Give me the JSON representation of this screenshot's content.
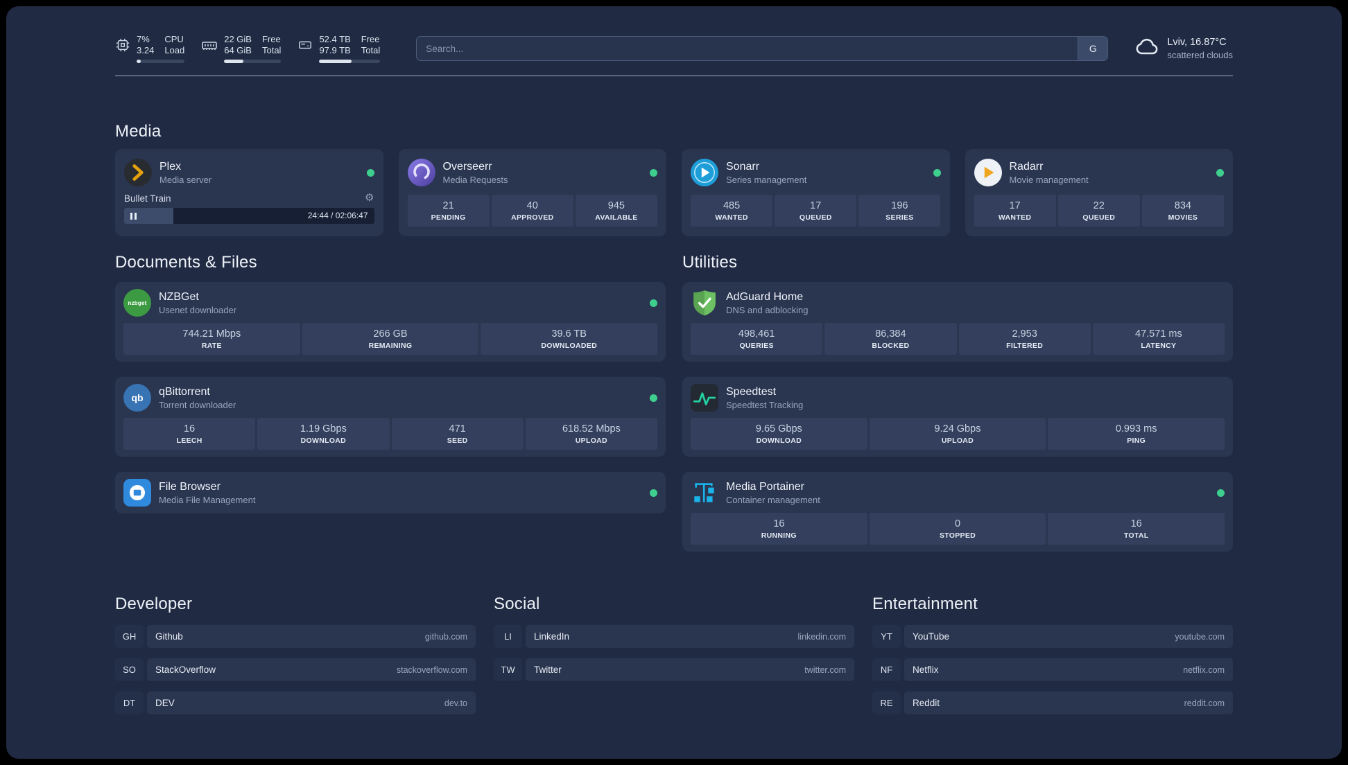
{
  "topbar": {
    "cpu": {
      "value_top": "7%",
      "value_bottom": "3.24",
      "label_top": "CPU",
      "label_bottom": "Load",
      "bar_width": "8%"
    },
    "memory": {
      "value_top": "22 GiB",
      "value_bottom": "64 GiB",
      "label_top": "Free",
      "label_bottom": "Total",
      "bar_width": "34%"
    },
    "disk": {
      "value_top": "52.4 TB",
      "value_bottom": "97.9 TB",
      "label_top": "Free",
      "label_bottom": "Total",
      "bar_width": "53%"
    },
    "search": {
      "placeholder": "Search...",
      "button_label": "G"
    },
    "weather": {
      "location": "Lviv, 16.87°C",
      "condition": "scattered clouds"
    }
  },
  "media": {
    "heading": "Media",
    "plex": {
      "name": "Plex",
      "desc": "Media server",
      "now_playing": "Bullet Train",
      "time": "24:44 / 02:06:47",
      "progress": "19.6%"
    },
    "overseerr": {
      "name": "Overseerr",
      "desc": "Media Requests",
      "stats": [
        {
          "value": "21",
          "label": "PENDING"
        },
        {
          "value": "40",
          "label": "APPROVED"
        },
        {
          "value": "945",
          "label": "AVAILABLE"
        }
      ]
    },
    "sonarr": {
      "name": "Sonarr",
      "desc": "Series management",
      "stats": [
        {
          "value": "485",
          "label": "WANTED"
        },
        {
          "value": "17",
          "label": "QUEUED"
        },
        {
          "value": "196",
          "label": "SERIES"
        }
      ]
    },
    "radarr": {
      "name": "Radarr",
      "desc": "Movie management",
      "stats": [
        {
          "value": "17",
          "label": "WANTED"
        },
        {
          "value": "22",
          "label": "QUEUED"
        },
        {
          "value": "834",
          "label": "MOVIES"
        }
      ]
    }
  },
  "documents": {
    "heading": "Documents & Files",
    "nzbget": {
      "name": "NZBGet",
      "desc": "Usenet downloader",
      "icon_text": "nzbget",
      "stats": [
        {
          "value": "744.21 Mbps",
          "label": "RATE"
        },
        {
          "value": "266 GB",
          "label": "REMAINING"
        },
        {
          "value": "39.6 TB",
          "label": "DOWNLOADED"
        }
      ]
    },
    "qbittorrent": {
      "name": "qBittorrent",
      "desc": "Torrent downloader",
      "icon_text": "qb",
      "stats": [
        {
          "value": "16",
          "label": "LEECH"
        },
        {
          "value": "1.19 Gbps",
          "label": "DOWNLOAD"
        },
        {
          "value": "471",
          "label": "SEED"
        },
        {
          "value": "618.52 Mbps",
          "label": "UPLOAD"
        }
      ]
    },
    "filebrowser": {
      "name": "File Browser",
      "desc": "Media File Management"
    }
  },
  "utilities": {
    "heading": "Utilities",
    "adguard": {
      "name": "AdGuard Home",
      "desc": "DNS and adblocking",
      "stats": [
        {
          "value": "498,461",
          "label": "QUERIES"
        },
        {
          "value": "86,384",
          "label": "BLOCKED"
        },
        {
          "value": "2,953",
          "label": "FILTERED"
        },
        {
          "value": "47.571 ms",
          "label": "LATENCY"
        }
      ]
    },
    "speedtest": {
      "name": "Speedtest",
      "desc": "Speedtest Tracking",
      "stats": [
        {
          "value": "9.65 Gbps",
          "label": "DOWNLOAD"
        },
        {
          "value": "9.24 Gbps",
          "label": "UPLOAD"
        },
        {
          "value": "0.993 ms",
          "label": "PING"
        }
      ]
    },
    "portainer": {
      "name": "Media Portainer",
      "desc": "Container management",
      "stats": [
        {
          "value": "16",
          "label": "RUNNING"
        },
        {
          "value": "0",
          "label": "STOPPED"
        },
        {
          "value": "16",
          "label": "TOTAL"
        }
      ]
    }
  },
  "bookmarks": {
    "developer": {
      "heading": "Developer",
      "items": [
        {
          "abbr": "GH",
          "name": "Github",
          "url": "github.com"
        },
        {
          "abbr": "SO",
          "name": "StackOverflow",
          "url": "stackoverflow.com"
        },
        {
          "abbr": "DT",
          "name": "DEV",
          "url": "dev.to"
        }
      ]
    },
    "social": {
      "heading": "Social",
      "items": [
        {
          "abbr": "LI",
          "name": "LinkedIn",
          "url": "linkedin.com"
        },
        {
          "abbr": "TW",
          "name": "Twitter",
          "url": "twitter.com"
        }
      ]
    },
    "entertainment": {
      "heading": "Entertainment",
      "items": [
        {
          "abbr": "YT",
          "name": "YouTube",
          "url": "youtube.com"
        },
        {
          "abbr": "NF",
          "name": "Netflix",
          "url": "netflix.com"
        },
        {
          "abbr": "RE",
          "name": "Reddit",
          "url": "reddit.com"
        }
      ]
    }
  },
  "colors": {
    "background": "#202b43",
    "card": "#2a3550",
    "stat_block": "#333f5d",
    "status_online": "#3ecf8e",
    "plex_amber": "#e5a00d",
    "overseerr_purple": "#5f4bb6",
    "sonarr_blue": "#1e9ed9",
    "radarr_orange": "#f0a521",
    "nzbget_green": "#3c9b42",
    "qbittorrent_blue": "#3873b3",
    "filebrowser_blue": "#2f89dc",
    "adguard_green": "#67bb5f",
    "speedtest_green": "#25d3a2",
    "portainer_blue": "#1ab3ea"
  }
}
